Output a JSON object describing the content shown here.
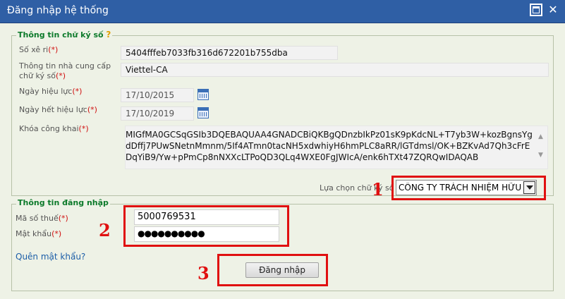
{
  "window": {
    "title": "Đăng nhập hệ thống"
  },
  "signature": {
    "legend": "Thông tin chữ ký số",
    "help_mark": "?",
    "serial_label": "Số xê ri",
    "serial_value": "5404fffeb7033fb316d672201b755dba",
    "provider_label": "Thông tin nhà cung cấp chữ ký số",
    "provider_value": "Viettel-CA",
    "valid_from_label": "Ngày hiệu lực",
    "valid_from_value": "17/10/2015",
    "valid_to_label": "Ngày hết hiệu lực",
    "valid_to_value": "17/10/2019",
    "public_key_label": "Khóa công khai",
    "public_key_value": "MIGfMA0GCSqGSIb3DQEBAQUAA4GNADCBiQKBgQDnzbIkPz01sK9pKdcNL+T7yb3W+kozBgnsYgdDffj7PUwSNetnMmnm/5If4ATmn0tacNH5xdwhiyH6hmPLC8aRR/lGTdmsl/OK+BZKvAd7Qh3cFrEDqYiB9/Yw+pPmCp8nNXXcLTPoQD3QLq4WXE0FgJWIcA/enk6hTXt47ZQRQwIDAQAB",
    "select_label": "Lựa chọn chữ ký số",
    "select_value": "CÔNG TY TRÁCH NHIỆM HỮU HẠN"
  },
  "login": {
    "legend": "Thông tin đăng nhập",
    "tax_label": "Mã số thuế",
    "tax_value": "5000769531",
    "password_label": "Mật khẩu",
    "password_value": "●●●●●●●●●●",
    "forgot_link": "Quên mật khẩu?",
    "submit_label": "Đăng nhập"
  },
  "required_mark": "(*)",
  "annotations": {
    "step1": "1",
    "step2": "2",
    "step3": "3"
  },
  "colors": {
    "titlebar": "#2f5fa5",
    "legend": "#0c7a2a",
    "required": "#d01010",
    "highlight": "#e01010",
    "link": "#1d5fa8"
  }
}
